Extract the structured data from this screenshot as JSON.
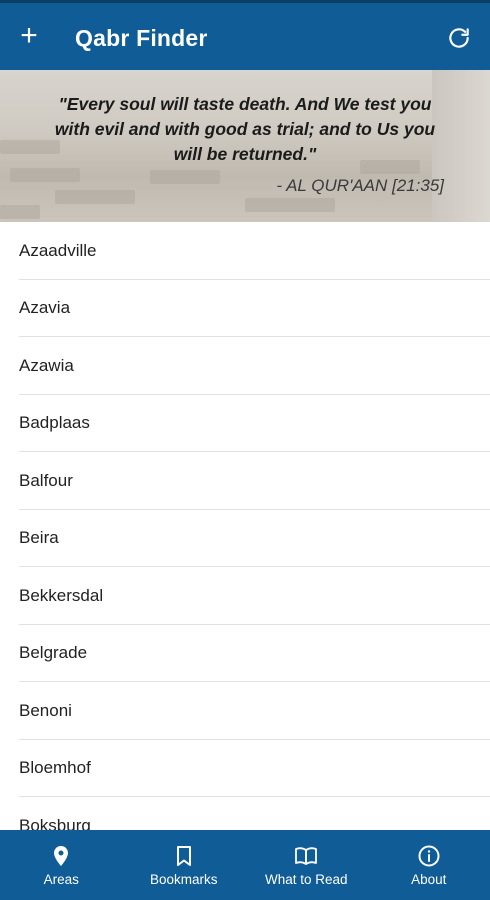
{
  "header": {
    "add_icon": "+",
    "title": "Qabr Finder",
    "refresh_icon": "refresh-icon"
  },
  "banner": {
    "quote": "\"Every soul will taste death. And We test you with evil and with good as trial; and to Us you will be returned.\"",
    "citation": "- AL QUR'AAN [21:35]"
  },
  "areas": [
    "Azaadville",
    "Azavia",
    "Azawia",
    "Badplaas",
    "Balfour",
    "Beira",
    "Bekkersdal",
    "Belgrade",
    "Benoni",
    "Bloemhof",
    "Boksburg"
  ],
  "bottom_nav": {
    "areas": {
      "label": "Areas",
      "icon": "map-pin-icon"
    },
    "bookmarks": {
      "label": "Bookmarks",
      "icon": "bookmark-icon"
    },
    "what_to_read": {
      "label": "What to Read",
      "icon": "book-icon"
    },
    "about": {
      "label": "About",
      "icon": "info-icon"
    }
  },
  "colors": {
    "primary": "#0f5c96",
    "text": "#222222",
    "divider": "#e2e2e2"
  }
}
